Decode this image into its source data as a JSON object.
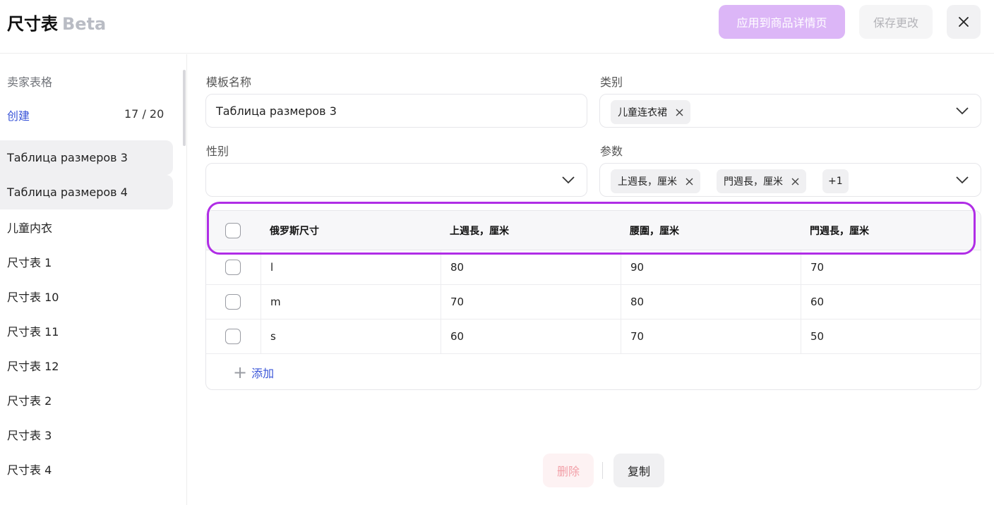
{
  "header": {
    "title": "尺寸表",
    "badge": "Beta",
    "apply_label": "应用到商品详情页",
    "save_label": "保存更改",
    "close_icon": "close-icon"
  },
  "sidebar": {
    "heading": "卖家表格",
    "create_label": "创建",
    "count": "17 / 20",
    "items": [
      {
        "label": "Таблица размеров 3",
        "active": true
      },
      {
        "label": "Таблица размеров 4",
        "active": true
      },
      {
        "label": "儿童内衣"
      },
      {
        "label": "尺寸表 1"
      },
      {
        "label": "尺寸表 10"
      },
      {
        "label": "尺寸表 11"
      },
      {
        "label": "尺寸表 12"
      },
      {
        "label": "尺寸表 2"
      },
      {
        "label": "尺寸表 3"
      },
      {
        "label": "尺寸表 4"
      }
    ]
  },
  "form": {
    "template_name_label": "模板名称",
    "template_name_value": "Таблица размеров 3",
    "category_label": "类别",
    "category_tags": [
      "儿童连衣裙"
    ],
    "gender_label": "性别",
    "gender_value": "",
    "params_label": "参数",
    "params_tags": [
      "上週長，厘米",
      "門週長，厘米"
    ],
    "params_more": "+1"
  },
  "table": {
    "headers": [
      "俄罗斯尺寸",
      "上週長，厘米",
      "腰圍，厘米",
      "門週長，厘米"
    ],
    "rows": [
      [
        "l",
        "80",
        "90",
        "70"
      ],
      [
        "m",
        "70",
        "80",
        "60"
      ],
      [
        "s",
        "60",
        "70",
        "50"
      ]
    ],
    "add_label": "添加"
  },
  "footer": {
    "delete_label": "删除",
    "copy_label": "复制"
  },
  "colors": {
    "accent": "#3a55d8",
    "apply_button": "#dcb6f7",
    "highlight": "#b02de6",
    "delete_text": "#f2a0a8"
  }
}
